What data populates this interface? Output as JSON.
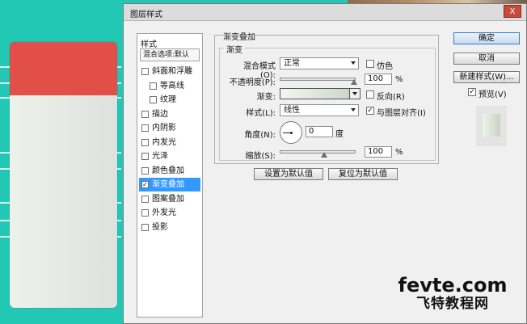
{
  "dialog": {
    "title": "图层样式",
    "close_label": "X"
  },
  "styles_panel": {
    "heading": "样式",
    "blend_options": "混合选项:默认",
    "items": [
      {
        "label": "斜面和浮雕",
        "checked": false,
        "sub": false,
        "active": false
      },
      {
        "label": "等高线",
        "checked": false,
        "sub": true,
        "active": false
      },
      {
        "label": "纹理",
        "checked": false,
        "sub": true,
        "active": false
      },
      {
        "label": "描边",
        "checked": false,
        "sub": false,
        "active": false
      },
      {
        "label": "内阴影",
        "checked": false,
        "sub": false,
        "active": false
      },
      {
        "label": "内发光",
        "checked": false,
        "sub": false,
        "active": false
      },
      {
        "label": "光泽",
        "checked": false,
        "sub": false,
        "active": false
      },
      {
        "label": "颜色叠加",
        "checked": false,
        "sub": false,
        "active": false
      },
      {
        "label": "渐变叠加",
        "checked": true,
        "sub": false,
        "active": true
      },
      {
        "label": "图案叠加",
        "checked": false,
        "sub": false,
        "active": false
      },
      {
        "label": "外发光",
        "checked": false,
        "sub": false,
        "active": false
      },
      {
        "label": "投影",
        "checked": false,
        "sub": false,
        "active": false
      }
    ]
  },
  "gradient_overlay": {
    "section_title": "渐变叠加",
    "subsection_title": "渐变",
    "blend_mode_label": "混合模式(O):",
    "blend_mode_value": "正常",
    "dither_label": "仿色",
    "opacity_label": "不透明度(P):",
    "opacity_value": "100",
    "opacity_unit": "%",
    "gradient_label": "渐变:",
    "reverse_label": "反向(R)",
    "style_label": "样式(L):",
    "style_value": "线性",
    "align_label": "与图层对齐(I)",
    "angle_label": "角度(N):",
    "angle_value": "0",
    "angle_unit": "度",
    "scale_label": "缩放(S):",
    "scale_value": "100",
    "scale_unit": "%",
    "set_default_button": "设置为默认值",
    "reset_default_button": "复位为默认值"
  },
  "right_buttons": {
    "ok": "确定",
    "cancel": "取消",
    "new_style": "新建样式(W)...",
    "preview_label": "预览(V)"
  },
  "checks": {
    "dither": false,
    "reverse": false,
    "align": true,
    "preview": true
  },
  "watermark": {
    "top": "fevte.com",
    "bottom": "飞特教程网"
  },
  "colors": {
    "background_teal": "#22c8b4",
    "card_red": "#e24f49",
    "card_body": "#eef1ea",
    "active_item": "#3399ff"
  }
}
